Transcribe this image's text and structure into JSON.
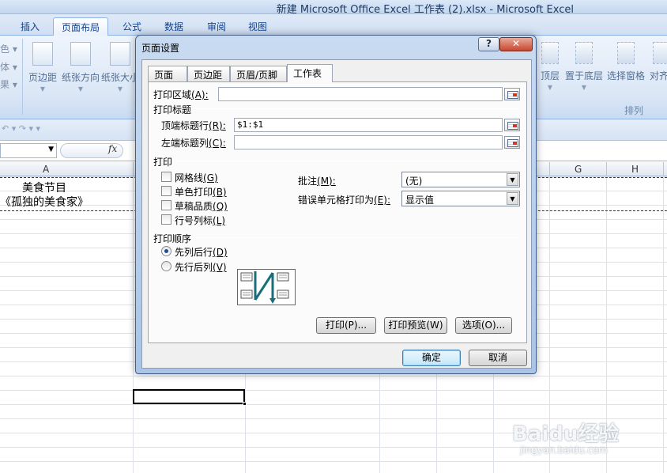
{
  "window": {
    "title": "新建 Microsoft Office Excel 工作表 (2).xlsx - Microsoft Excel"
  },
  "ribbon": {
    "tabs": [
      {
        "label": "插入"
      },
      {
        "label": "页面布局",
        "active": true
      },
      {
        "label": "公式"
      },
      {
        "label": "数据"
      },
      {
        "label": "审阅"
      },
      {
        "label": "视图"
      }
    ],
    "left_clipped": [
      "色 ▾",
      "体 ▾",
      "果 ▾"
    ],
    "left_buttons": [
      "页边距",
      "纸张方向",
      "纸张大小"
    ],
    "right_buttons": [
      "顶层",
      "置于底层",
      "选择窗格",
      "对齐"
    ],
    "group_label": "排列"
  },
  "formula_bar": {
    "fx_label": "fx"
  },
  "sheet": {
    "columns_left": [
      "A"
    ],
    "columns_right": [
      "G",
      "H"
    ],
    "cells": {
      "a1": "美食节目",
      "a2": "《孤独的美食家》"
    }
  },
  "dialog": {
    "title": "页面设置",
    "help_label": "?",
    "close_label": "✕",
    "tabs": [
      {
        "label": "页面"
      },
      {
        "label": "页边距"
      },
      {
        "label": "页眉/页脚"
      },
      {
        "label": "工作表",
        "active": true
      }
    ],
    "print_area": {
      "label": "打印区域",
      "key": "(A):",
      "key_letter": "A",
      "value": ""
    },
    "print_titles": {
      "section_label": "打印标题",
      "rows": {
        "label": "顶端标题行",
        "key": "(R):",
        "value": "$1:$1"
      },
      "cols": {
        "label": "左端标题列",
        "key": "(C):",
        "value": ""
      }
    },
    "print": {
      "section_label": "打印",
      "checkboxes": [
        {
          "label": "网格线",
          "key": "(G)",
          "checked": false
        },
        {
          "label": "单色打印",
          "key": "(B)",
          "checked": false
        },
        {
          "label": "草稿品质",
          "key": "(Q)",
          "checked": false
        },
        {
          "label": "行号列标",
          "key": "(L)",
          "checked": false
        }
      ],
      "comments": {
        "label": "批注",
        "key": "(M):",
        "value": "(无)"
      },
      "errors": {
        "label": "错误单元格打印为",
        "key": "(E):",
        "value": "显示值"
      }
    },
    "page_order": {
      "section_label": "打印顺序",
      "options": [
        {
          "label": "先列后行",
          "key": "(D)",
          "selected": true
        },
        {
          "label": "先行后列",
          "key": "(V)",
          "selected": false
        }
      ]
    },
    "panel_buttons": {
      "print": "打印(P)...",
      "preview": "打印预览(W)",
      "options": "选项(O)..."
    },
    "ok": "确定",
    "cancel": "取消"
  },
  "watermark": {
    "brand": "Baidu经验",
    "url": "jingyan.baidu.com"
  }
}
